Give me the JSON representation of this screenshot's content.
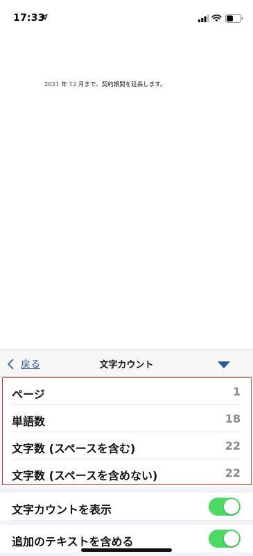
{
  "status_bar": {
    "time": "17:33",
    "location_icon": "location-arrow-icon",
    "signal_icon": "cellular-signal-icon",
    "wifi_icon": "wifi-icon",
    "battery_icon": "battery-icon"
  },
  "document": {
    "text": "2021 年 12 月まで、契約期間を延長します。"
  },
  "panel": {
    "back_label": "戻る",
    "back_icon": "chevron-left-icon",
    "title": "文字カウント",
    "dropdown_icon": "triangle-down-icon",
    "accent_color": "#2b579a",
    "stats": [
      {
        "label": "ページ",
        "value": "1"
      },
      {
        "label": "単語数",
        "value": "18"
      },
      {
        "label": "文字数 (スペースを含む)",
        "value": "22"
      },
      {
        "label": "文字数 (スペースを含めない)",
        "value": "22"
      }
    ],
    "highlight_color": "#e03030",
    "options": [
      {
        "label": "文字カウントを表示",
        "enabled": true
      },
      {
        "label": "追加のテキストを含める",
        "enabled": true
      }
    ],
    "toggle_on_color": "#4cd964"
  }
}
